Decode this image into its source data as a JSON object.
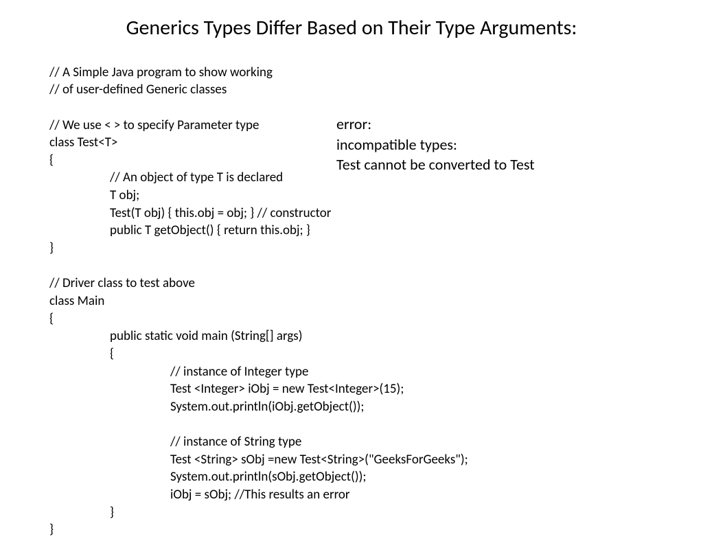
{
  "title": "Generics Types Differ Based on Their Type Arguments:",
  "code": {
    "l1": "// A Simple Java program to show working",
    "l2": "// of user-defined Generic classes",
    "l3": "",
    "l4": "// We use < > to specify Parameter type",
    "l5": "class Test<T>",
    "l6": "{",
    "l7": "// An object of type T is declared",
    "l8": "T obj;",
    "l9": "Test(T obj) { this.obj = obj; } // constructor",
    "l10": "public T getObject() { return this.obj; }",
    "l11": "}",
    "l12": "",
    "l13": "// Driver class to test above",
    "l14": "class Main",
    "l15": "{",
    "l16": "public static void main (String[] args)",
    "l17": "{",
    "l18": "// instance of Integer type",
    "l19": "Test <Integer> iObj = new Test<Integer>(15);",
    "l20": "System.out.println(iObj.getObject());",
    "l21": "",
    "l22": "// instance of String type",
    "l23": "Test <String> sObj =new Test<String>(\"GeeksForGeeks\");",
    "l24": "System.out.println(sObj.getObject());",
    "l25": "iObj = sObj; //This results an error",
    "l26": "}",
    "l27": "}"
  },
  "error": {
    "l1": "error:",
    "l2": " incompatible types:",
    "l3": " Test cannot be converted to Test"
  }
}
